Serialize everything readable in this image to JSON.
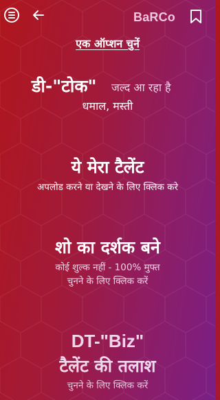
{
  "header": {
    "brand": "BaRCo",
    "icons": [
      "menu-icon",
      "back-arrow-icon",
      "bookmark-icon"
    ]
  },
  "heading": "एक ऑप्शन चुनें",
  "options": [
    {
      "title": "डी-\"टोक\"",
      "badge": "जल्द आ रहा है",
      "subtitle": "धमाल, मस्ती"
    },
    {
      "title": "ये मेरा टैलेंट",
      "subtitle": "अपलोड करने या देखने के लिए क्लिक करे"
    },
    {
      "title": "शो का दर्शक बने",
      "line1": "कोई शुल्क नहीं - 100% मुफ्त",
      "line2": "चुनने के लिए क्लिक करें"
    },
    {
      "title_line1": "DT-\"Biz\"",
      "title_line2": "टैलेंट की तलाश",
      "subtitle": "चुनने के लिए क्लिक करें"
    }
  ],
  "colors": {
    "gradient_left": "#b0161d",
    "gradient_right": "#7a1f86",
    "brand_text": "#f0c6e0"
  }
}
